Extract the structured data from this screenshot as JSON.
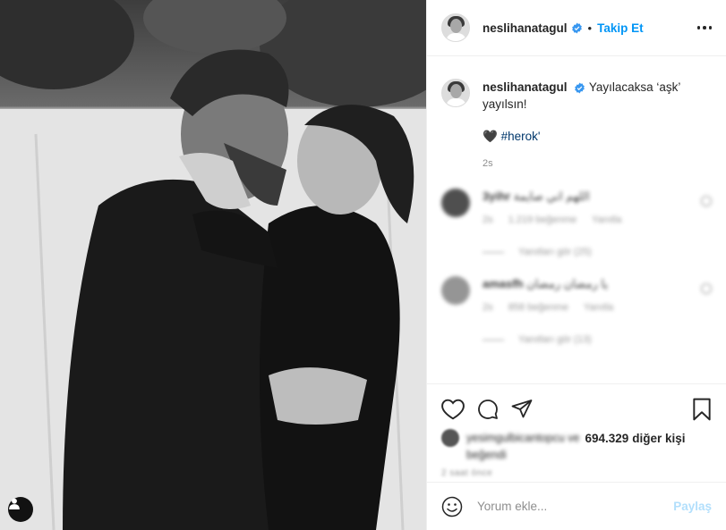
{
  "post": {
    "username": "neslihanatagul",
    "follow_label": "Takip Et",
    "separator": "•",
    "caption_text": "Yayılacaksa ‘aşk’ yayılsın!",
    "caption_emoji": "🖤",
    "hashtag": "#herok'",
    "time": "2s"
  },
  "comments": [
    {
      "username": "3yihr",
      "text": "اللهم اني صايمة",
      "time": "2s",
      "likes": "1.219 beğenme",
      "reply": "Yanıtla",
      "view_replies": "Yanıtları gör (25)"
    },
    {
      "username": "amasfh",
      "text": "يا رمضان رمضان",
      "time": "2s",
      "likes": "858 beğenme",
      "reply": "Yanıtla",
      "view_replies": "Yanıtları gör (13)"
    }
  ],
  "likes": {
    "liked_by_blurred": "yesimgulbicantopcu ve",
    "count": "694.329",
    "others": "diğer kişi",
    "line2_blurred": "beğendi",
    "date_blurred": "2 saat önce"
  },
  "add_comment": {
    "placeholder": "Yorum ekle...",
    "share_label": "Paylaş"
  },
  "icons": {
    "verified": "verified-badge-icon",
    "more": "more-options-icon",
    "like": "heart-icon",
    "comment": "comment-icon",
    "share": "paper-plane-icon",
    "save": "bookmark-icon",
    "emoji": "emoji-icon",
    "tags": "user-tag-icon"
  },
  "colors": {
    "accent": "#0095f6",
    "verified": "#3897f0",
    "share_disabled": "#b2dffc",
    "hashtag": "#00376b"
  }
}
